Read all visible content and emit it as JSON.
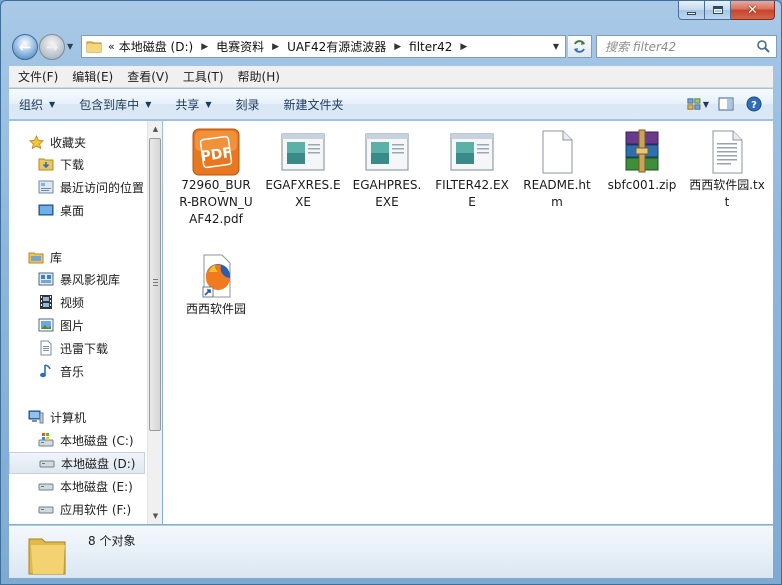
{
  "window": {
    "caption_buttons": {
      "minimize": "minimize-icon",
      "maximize": "maximize-icon",
      "close": "close-icon"
    }
  },
  "navigation": {
    "back": "back-arrow-icon",
    "forward": "forward-arrow-icon",
    "overflow": "«",
    "breadcrumbs": [
      "本地磁盘 (D:)",
      "电赛资料",
      "UAF42有源滤波器",
      "filter42"
    ],
    "search_placeholder": "搜索 filter42"
  },
  "menubar": {
    "items": [
      "文件(F)",
      "编辑(E)",
      "查看(V)",
      "工具(T)",
      "帮助(H)"
    ]
  },
  "commandbar": {
    "organize": "组织",
    "include_in_library": "包含到库中",
    "share": "共享",
    "burn": "刻录",
    "new_folder": "新建文件夹"
  },
  "sidebar": {
    "favorites": {
      "label": "收藏夹",
      "items": [
        "下载",
        "最近访问的位置",
        "桌面"
      ]
    },
    "libraries": {
      "label": "库",
      "items": [
        "暴风影视库",
        "视频",
        "图片",
        "迅雷下载",
        "音乐"
      ]
    },
    "computer": {
      "label": "计算机",
      "items": [
        "本地磁盘 (C:)",
        "本地磁盘 (D:)",
        "本地磁盘 (E:)",
        "应用软件 (F:)"
      ],
      "selected": "本地磁盘 (D:)"
    }
  },
  "files": [
    {
      "name": "72960_BURR-BROWN_UAF42.pdf",
      "icon": "pdf-file-icon"
    },
    {
      "name": "EGAFXRES.EXE",
      "icon": "exe-window-icon"
    },
    {
      "name": "EGAHPRES.EXE",
      "icon": "exe-window-icon"
    },
    {
      "name": "FILTER42.EXE",
      "icon": "exe-window-icon"
    },
    {
      "name": "README.htm",
      "icon": "blank-document-icon"
    },
    {
      "name": "sbfc001.zip",
      "icon": "winrar-archive-icon"
    },
    {
      "name": "西西软件园.txt",
      "icon": "text-document-icon"
    },
    {
      "name": "西西软件园",
      "icon": "firefox-shortcut-icon"
    }
  ],
  "status": {
    "count": "8 个对象"
  },
  "colors": {
    "frame": "#8fb7dc",
    "accent": "#1e395b",
    "pdf_orange": "#e8781f",
    "selection": "#dfe7f1"
  }
}
